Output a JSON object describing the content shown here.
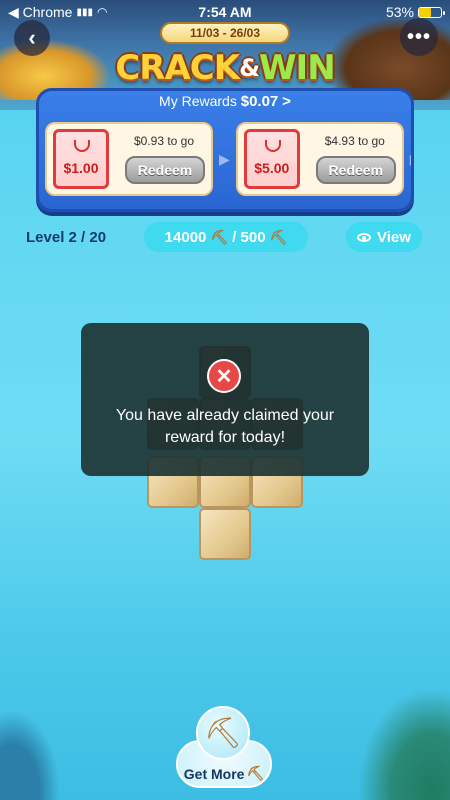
{
  "status_bar": {
    "back_app": "◀ Chrome",
    "time": "7:54 AM",
    "battery": "53%",
    "battery_level": 0.53
  },
  "header": {
    "date_range": "11/03 - 26/03",
    "logo_part1": "CRACK",
    "logo_amp": "&",
    "logo_part2": "WIN"
  },
  "rewards": {
    "title_label": "My Rewards",
    "title_amount": "$0.07",
    "title_chevron": ">",
    "cards": [
      {
        "amount": "$1.00",
        "to_go": "$0.93 to go",
        "button": "Redeem"
      },
      {
        "amount": "$5.00",
        "to_go": "$4.93 to go",
        "button": "Redeem"
      }
    ]
  },
  "progress": {
    "level": "Level 2 / 20",
    "picks_current": "14000",
    "picks_sep": "/ 500",
    "view_label": "View"
  },
  "toast": {
    "message": "You have already claimed your reward for today!"
  },
  "bottom": {
    "get_more_label": "Get More"
  },
  "icons": {
    "back": "chevron-left-icon",
    "more": "more-dots-icon",
    "pickaxe": "pickaxe-icon",
    "eye": "eye-icon",
    "error": "close-icon"
  }
}
